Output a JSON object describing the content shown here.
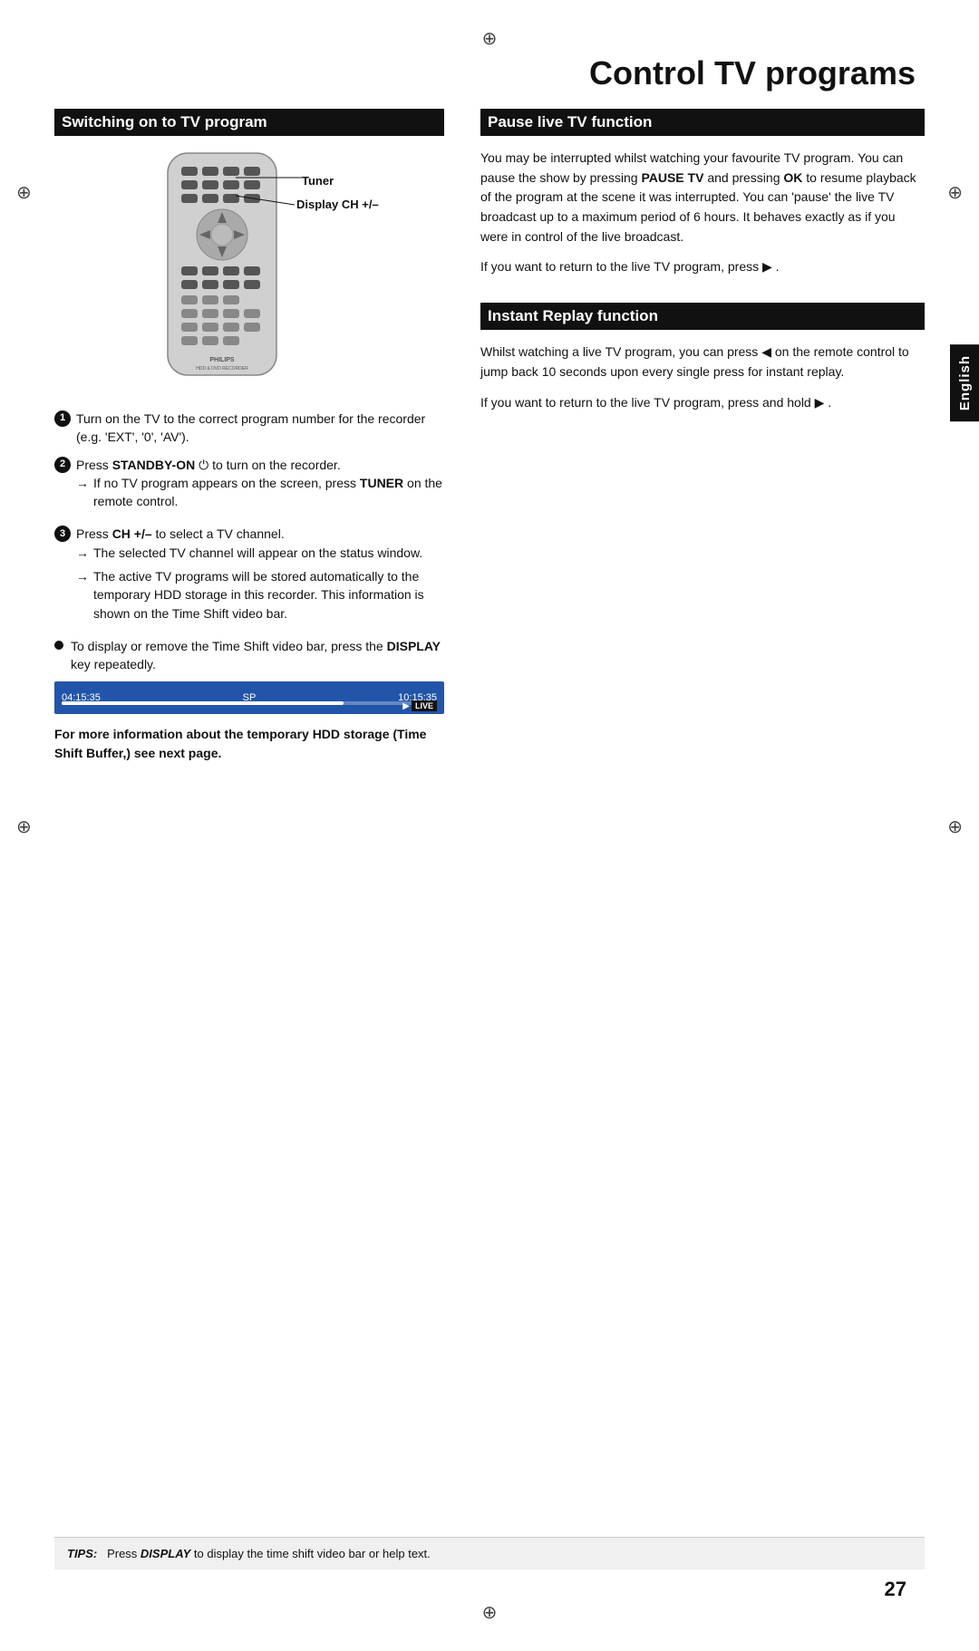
{
  "page": {
    "number": "27",
    "title": "Control TV programs",
    "registration_mark": "⊕"
  },
  "english_tab": {
    "label": "English"
  },
  "left_column": {
    "section_header": "Switching on to TV program",
    "remote_callouts": [
      {
        "label": "Tuner"
      },
      {
        "label": "Display CH +/–"
      }
    ],
    "steps": [
      {
        "number": "1",
        "text": "Turn on the TV to the correct program number for the recorder (e.g. 'EXT', '0', 'AV').",
        "arrows": []
      },
      {
        "number": "2",
        "text": "Press STANDBY-ON ⏻ to turn on the recorder.",
        "arrows": [
          "If no TV program appears on the screen, press TUNER on the remote control."
        ]
      },
      {
        "number": "3",
        "text": "Press CH +/– to select a TV channel.",
        "arrows": [
          "The selected TV channel will appear on the status window.",
          "The active TV programs will be stored automatically to the temporary HDD storage in this recorder. This information is shown on the Time Shift video bar."
        ]
      }
    ],
    "bullet": {
      "text": "To display or remove the Time Shift video bar, press the DISPLAY  key repeatedly."
    },
    "timeshift": {
      "time_left": "04:15:35",
      "sp_label": "SP",
      "time_right": "10:15:35",
      "live_label": "LIVE",
      "fill_percent": 75
    },
    "bold_note": "For more information about the temporary HDD storage (Time Shift Buffer,) see next page."
  },
  "right_column": {
    "pause_section": {
      "header": "Pause live TV function",
      "paragraphs": [
        "You may be interrupted whilst watching your favourite TV program.  You can pause the show by pressing PAUSE TV and pressing OK to resume playback of the program at the scene it was interrupted. You can 'pause' the live TV broadcast up to a maximum period of 6 hours. It behaves exactly as if you were in control of the live broadcast.",
        "If you want to return to the live TV program, press ▶ ."
      ]
    },
    "instant_section": {
      "header": "Instant Replay function",
      "paragraphs": [
        "Whilst watching a live TV program, you can press ◀ on the remote control to jump back 10 seconds upon every single press for instant replay.",
        "If you want to return to the live TV program, press and hold ▶ ."
      ]
    }
  },
  "tips_bar": {
    "tips_label": "TIPS:",
    "tips_text": "Press DISPLAY to display the time shift video bar or help text."
  }
}
